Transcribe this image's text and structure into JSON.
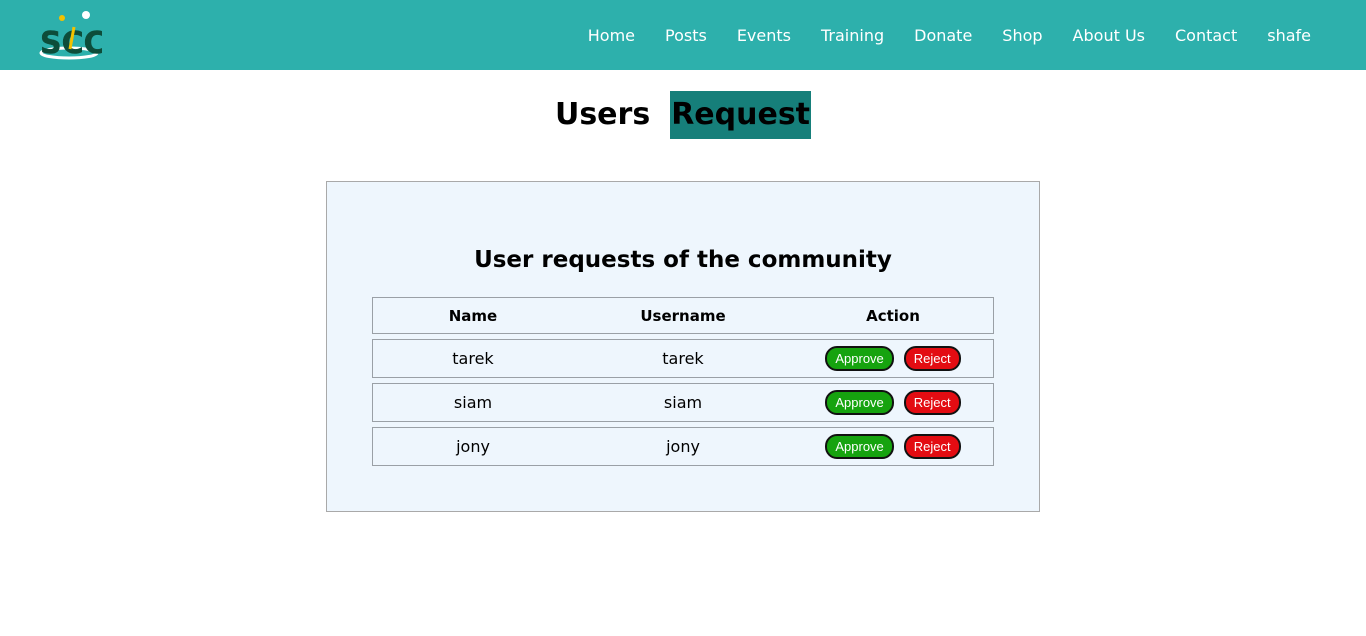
{
  "nav": {
    "logo_text": "SCC",
    "links": [
      "Home",
      "Posts",
      "Events",
      "Training",
      "Donate",
      "Shop",
      "About Us",
      "Contact",
      "shafe"
    ]
  },
  "page": {
    "title_part1": "Users",
    "title_part2": "Request"
  },
  "panel": {
    "heading": "User requests of the community",
    "columns": [
      "Name",
      "Username",
      "Action"
    ],
    "rows": [
      {
        "name": "tarek",
        "username": "tarek"
      },
      {
        "name": "siam",
        "username": "siam"
      },
      {
        "name": "jony",
        "username": "jony"
      }
    ],
    "approve_label": "Approve",
    "reject_label": "Reject"
  },
  "colors": {
    "navbar": "#2db0ac",
    "title_highlight": "#167f7a",
    "panel_bg": "#eef6fd",
    "approve": "#16a30f",
    "reject": "#e30c12"
  }
}
